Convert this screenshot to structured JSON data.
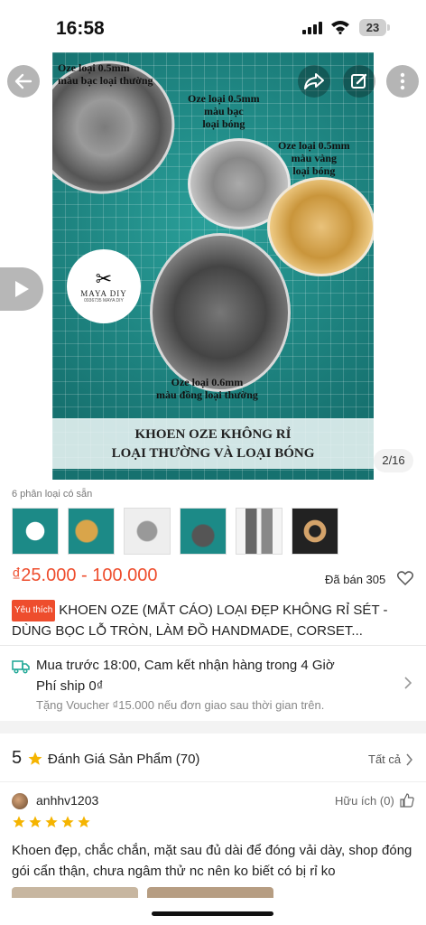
{
  "status_bar": {
    "time": "16:58",
    "battery": "23"
  },
  "gallery": {
    "counter": "2/16",
    "photo_labels": [
      "Oze loại 0.5mm\nmàu bạc loại thường",
      "Oze loại 0.5mm\nmàu bạc\nloại bóng",
      "Oze loại 0.5mm\nmàu vàng\nloại bóng",
      "Oze loại 0.6mm\nmàu đồng loại thường"
    ],
    "banner_line1": "KHOEN OZE KHÔNG RỈ",
    "banner_line2": "LOẠI THƯỜNG VÀ LOẠI BÓNG",
    "logo_text": "MAYA DIY",
    "logo_subtext": "0936735 MAYA DIY"
  },
  "variants": {
    "label": "6 phân loại có sẵn",
    "count": 6
  },
  "product": {
    "price_range": "₫25.000 - 100.000",
    "sold": "Đã bán 305",
    "badge": "Yêu thích",
    "title": "KHOEN OZE (MẮT CÁO) LOẠI ĐẸP KHÔNG RỈ SÉT - DÙNG BỌC LỖ TRÒN, LÀM ĐỒ HANDMADE, CORSET..."
  },
  "shipping": {
    "line1": "Mua trước 18:00, Cam kết nhận hàng trong 4 Giờ",
    "line2": "Phí ship 0₫",
    "line3": "Tặng Voucher ₫15.000 nếu đơn giao sau thời gian trên."
  },
  "reviews": {
    "score": "5",
    "title": "Đánh Giá Sản Phẩm (70)",
    "see_all": "Tất cả",
    "items": [
      {
        "user": "anhhv1203",
        "helpful": "Hữu ích (0)",
        "rating": 5,
        "text": "Khoen đẹp, chắc chắn, mặt sau đủ dài để đóng vải dày,  shop đóng gói cẩn thận, chưa ngâm thử nc nên ko biết có bị rỉ ko"
      }
    ]
  },
  "colors": {
    "accent": "#ee4d2d",
    "star": "#f5b400",
    "truck": "#26aa99"
  }
}
